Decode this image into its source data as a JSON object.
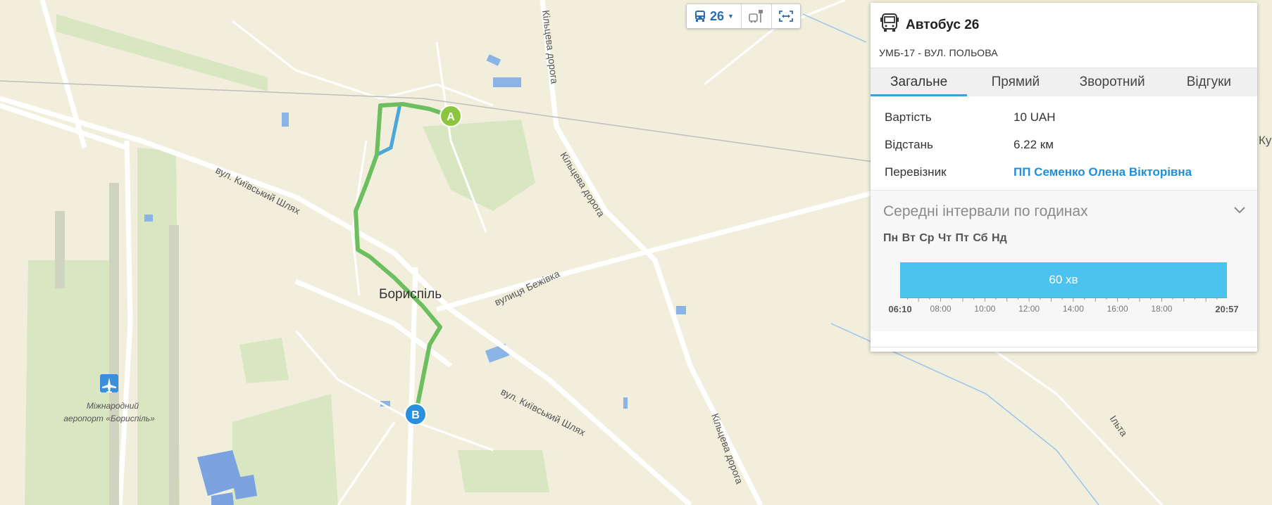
{
  "toolbar": {
    "route_label": "26"
  },
  "map": {
    "labels": {
      "city": "Бориспіль",
      "airport_line1": "Міжнародний",
      "airport_line2": "аеропорт «Бориспіль»",
      "street_kyivskyi_1": "вул. Київський Шлях",
      "street_kyivskyi_2": "вул. Київський Шлях",
      "street_bezhivka": "вулиця Бежівка",
      "ring_road_1": "Кільцева дорога",
      "ring_road_2": "Кільцева дорога",
      "ring_road_3": "Кільцева дорога",
      "ilta": "Ільта",
      "edge_text": "Ку"
    },
    "markers": {
      "start": "A",
      "end": "B"
    },
    "colors": {
      "route": "#6cbf5e",
      "route_alt": "#4aa8d8",
      "marker_a": "#8cc63f",
      "marker_b": "#2b8fe0"
    }
  },
  "panel": {
    "title": "Автобус 26",
    "subtitle": "УМБ-17 - ВУЛ. ПОЛЬОВА",
    "tabs": [
      "Загальне",
      "Прямий",
      "Зворотний",
      "Відгуки"
    ],
    "info": {
      "cost_label": "Вартість",
      "cost_value": "10 UAH",
      "distance_label": "Відстань",
      "distance_value": "6.22 км",
      "carrier_label": "Перевізник",
      "carrier_value": "ПП Семенко Олена Вікторівна"
    },
    "intervals": {
      "title": "Середні інтервали по годинах",
      "days": "Пн Вт Ср Чт Пт Сб Нд",
      "bar_label": "60 хв",
      "start_time": "06:10",
      "end_time": "20:57",
      "ticks": [
        "08:00",
        "10:00",
        "12:00",
        "14:00",
        "16:00",
        "18:00"
      ]
    }
  }
}
